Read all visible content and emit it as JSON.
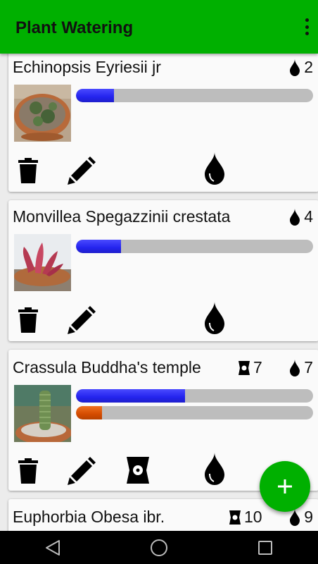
{
  "app": {
    "title": "Plant Watering"
  },
  "icons": {
    "menu": "overflow-menu-icon",
    "delete": "trash-icon",
    "edit": "pencil-icon",
    "water": "water-drop-icon",
    "fertilizer": "fertilizer-bag-icon",
    "add": "plus-icon",
    "nav_back": "back-triangle-icon",
    "nav_home": "home-circle-icon",
    "nav_recents": "recents-square-icon"
  },
  "colors": {
    "app_bar": "#00b000",
    "fab": "#00b000",
    "water_bar": "#2a2aee",
    "fertilizer_bar": "#d44c00",
    "bar_track": "#bdbdbd"
  },
  "plants": [
    {
      "name": "Echinopsis Eyriesii jr",
      "water_days": "2",
      "water_level": 0.16
    },
    {
      "name": "Monvillea Spegazzinii crestata",
      "water_days": "4",
      "water_level": 0.19
    },
    {
      "name": "Crassula Buddha's temple",
      "fertilizer_days": "7",
      "water_days": "7",
      "water_level": 0.46,
      "fertilizer_level": 0.11
    },
    {
      "name": "Euphorbia Obesa ibr.",
      "fertilizer_days": "10",
      "water_days": "9"
    }
  ]
}
